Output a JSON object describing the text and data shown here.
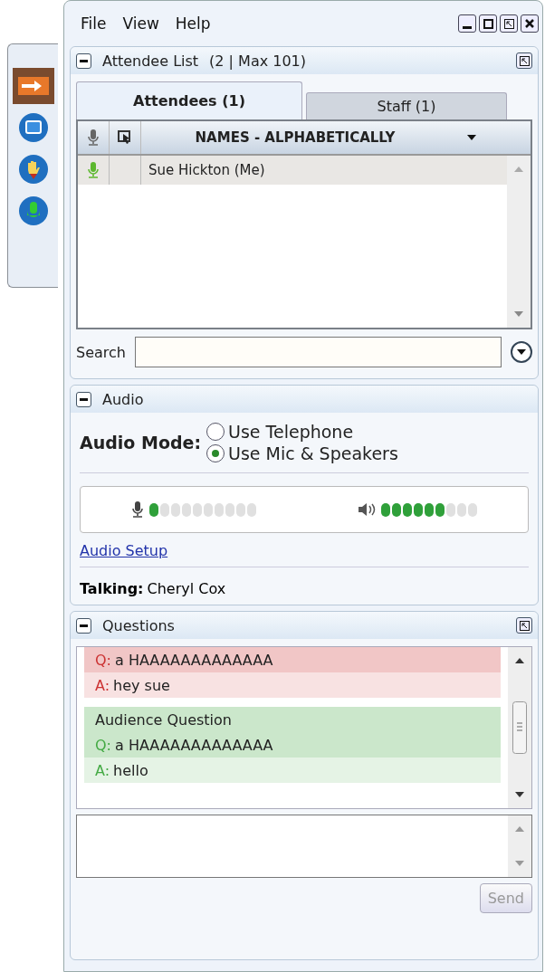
{
  "toolbar": {
    "items": [
      {
        "kind": "arrow",
        "selected": true
      },
      {
        "kind": "screen",
        "selected": false
      },
      {
        "kind": "hand",
        "selected": false
      },
      {
        "kind": "mic",
        "selected": false
      }
    ]
  },
  "menu": [
    "File",
    "View",
    "Help"
  ],
  "attendee_panel": {
    "title": "Attendee List",
    "count": "(2 | Max 101)",
    "tabs": [
      {
        "label": "Attendees (1)",
        "selected": true
      },
      {
        "label": "Staff (1)",
        "selected": false
      }
    ],
    "column": "NAMES - ALPHABETICALLY",
    "rows": [
      {
        "name": "Sue Hickton (Me)",
        "talking": true,
        "selected": true
      }
    ],
    "search_label": "Search"
  },
  "audio_panel": {
    "title": "Audio",
    "mode_label": "Audio Mode:",
    "options": [
      {
        "label": "Use Telephone",
        "selected": false
      },
      {
        "label": "Use Mic & Speakers",
        "selected": true
      }
    ],
    "meters": [
      {
        "kind": "mic",
        "level": 0.1
      },
      {
        "kind": "speaker",
        "level": 0.667
      }
    ],
    "setup_link": "Audio Setup",
    "talking_label": "Talking:",
    "talking_name": "Cheryl Cox"
  },
  "questions_panel": {
    "title": "Questions",
    "items": [
      {
        "color": "#cc3333",
        "q_label": "Q:",
        "question": "a HAAAAAAAAAAAAA",
        "a_label": "A:",
        "answer": "hey sue"
      },
      {
        "color": "#44aa44",
        "heading": "Audience Question",
        "q_label": "Q:",
        "question": "a HAAAAAAAAAAAAA",
        "a_label": "A:",
        "answer": "hello"
      }
    ],
    "send": "Send"
  }
}
